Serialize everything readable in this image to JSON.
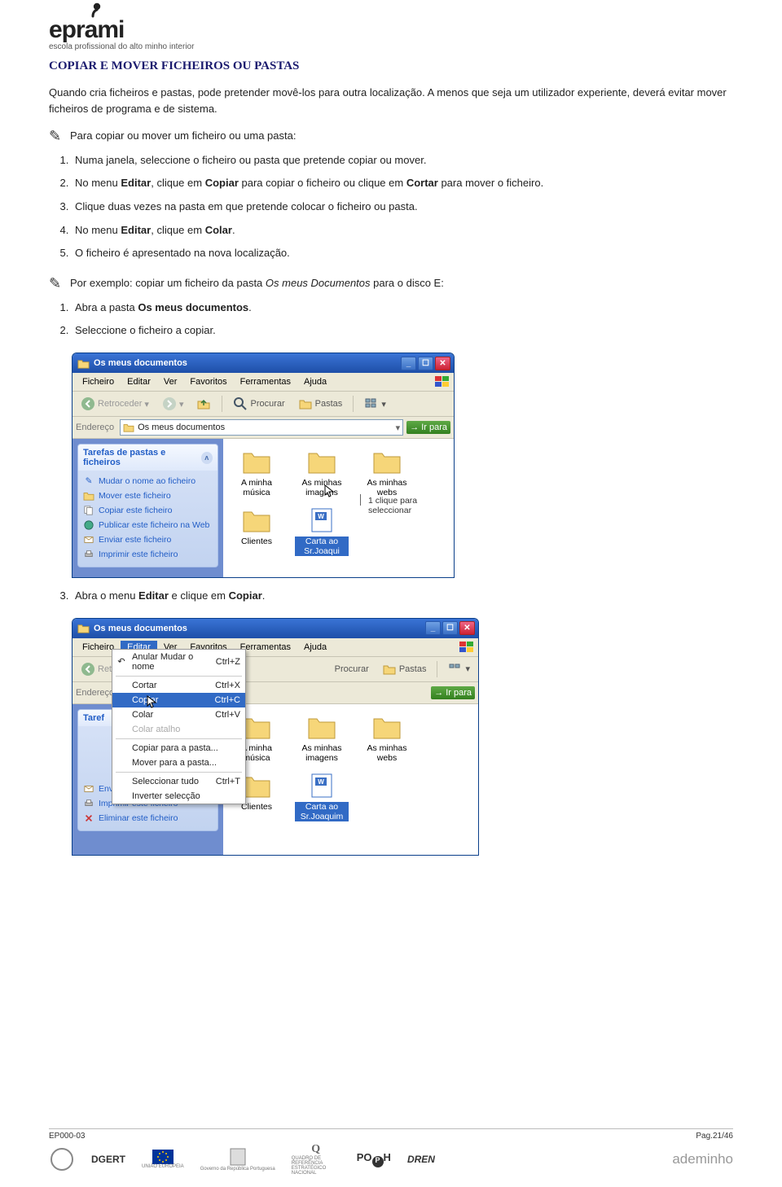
{
  "header": {
    "logo_text": "eprami",
    "logo_sub": "escola profissional do alto minho interior"
  },
  "doc": {
    "section_title": "COPIAR E MOVER FICHEIROS OU PASTAS",
    "intro": "Quando cria ficheiros e pastas, pode pretender movê-los para outra localização. A menos que seja um utilizador experiente, deverá evitar mover ficheiros de programa e de sistema.",
    "proc_heading": "Para copiar ou mover um ficheiro ou uma pasta:",
    "steps": {
      "s1": "Numa janela, seleccione o ficheiro ou pasta que pretende copiar ou mover.",
      "s2a": "No menu ",
      "s2b": "Editar",
      "s2c": ", clique em ",
      "s2d": "Copiar",
      "s2e": " para copiar o ficheiro ou clique em ",
      "s2f": "Cortar",
      "s2g": " para mover o ficheiro.",
      "s3": "Clique duas vezes na pasta em que pretende colocar o ficheiro ou pasta.",
      "s4a": "No menu ",
      "s4b": "Editar",
      "s4c": ", clique em ",
      "s4d": "Colar",
      "s4e": ".",
      "s5": "O ficheiro é apresentado na nova localização."
    },
    "ex_heading_a": "Por exemplo: copiar um ficheiro da pasta ",
    "ex_heading_b": "Os meus Documentos",
    "ex_heading_c": " para o disco E:",
    "ex1a": "Abra a pasta ",
    "ex1b": "Os meus documentos",
    "ex1c": ".",
    "ex2": "Seleccione o ficheiro a copiar.",
    "ex3a": "Abra o menu ",
    "ex3b": "Editar",
    "ex3c": " e clique em ",
    "ex3d": "Copiar",
    "ex3e": "."
  },
  "xp": {
    "title": "Os meus documentos",
    "menus": {
      "file": "Ficheiro",
      "edit": "Editar",
      "view": "Ver",
      "fav": "Favoritos",
      "tools": "Ferramentas",
      "help": "Ajuda"
    },
    "toolbar": {
      "back": "Retroceder",
      "search": "Procurar",
      "folders": "Pastas"
    },
    "addrbar": {
      "label": "Endereço",
      "text": "Os meus documentos",
      "go": "Ir para"
    },
    "pane_head": "Tarefas de pastas e ficheiros",
    "tasks": {
      "rename": "Mudar o nome ao ficheiro",
      "move": "Mover este ficheiro",
      "copy": "Copiar este ficheiro",
      "publish": "Publicar este ficheiro na Web",
      "send": "Enviar este ficheiro",
      "print": "Imprimir este ficheiro",
      "delete": "Eliminar este ficheiro"
    },
    "icons": {
      "music": "A minha música",
      "images": "As minhas imagens",
      "webs": "As minhas webs",
      "clients": "Clientes",
      "carta_sel": "Carta ao Sr.Joaqui",
      "carta": "Carta ao Sr.Joaquim"
    },
    "callout": "1 clique para seleccionar",
    "dropdown": {
      "undo": "Anular Mudar o nome",
      "undo_sc": "Ctrl+Z",
      "cut": "Cortar",
      "cut_sc": "Ctrl+X",
      "copy": "Copiar",
      "copy_sc": "Ctrl+C",
      "paste": "Colar",
      "paste_sc": "Ctrl+V",
      "paste_shortcut": "Colar atalho",
      "copy_to": "Copiar para a pasta...",
      "move_to": "Mover para a pasta...",
      "select_all": "Seleccionar tudo",
      "select_all_sc": "Ctrl+T",
      "invert": "Inverter selecção"
    }
  },
  "footer": {
    "left": "EP000-03",
    "right": "Pag.21/46",
    "logos": {
      "dgert": "DGERT",
      "eu": "UNIÃO EUROPEIA",
      "gov": "Governo da República Portuguesa",
      "qren": "QUADRO DE REFERÊNCIA ESTRATÉGICO NACIONAL",
      "poph": "POPH",
      "dren": "DREN",
      "adem": "ademinho"
    }
  }
}
